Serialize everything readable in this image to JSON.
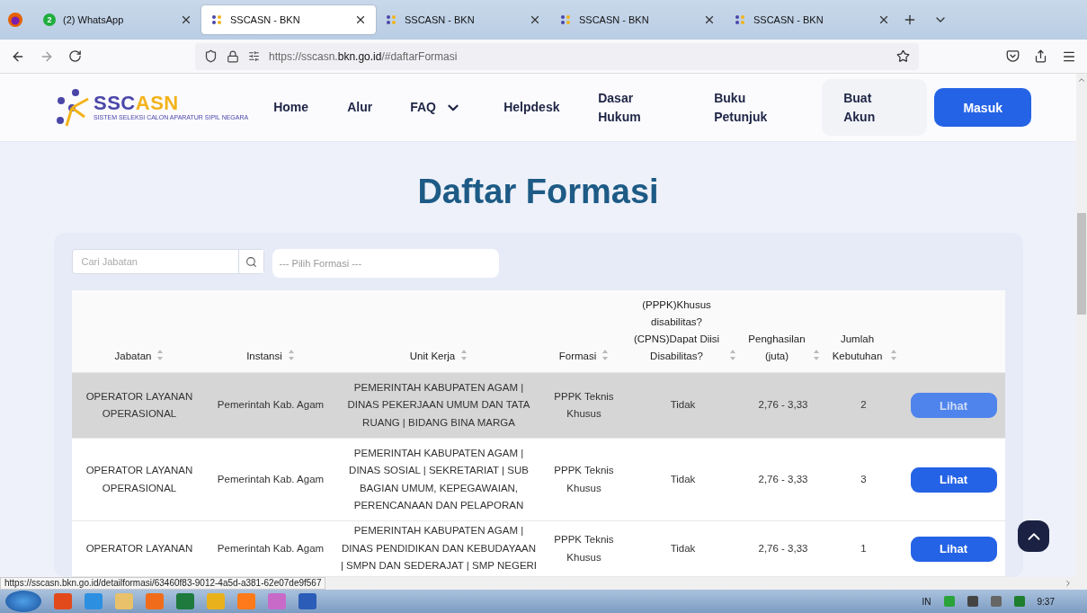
{
  "browser": {
    "tabs": [
      {
        "label": "(2) WhatsApp",
        "badge": "2",
        "kind": "whatsapp",
        "selected": false
      },
      {
        "label": "SSCASN - BKN",
        "kind": "sscasn",
        "selected": true
      },
      {
        "label": "SSCASN - BKN",
        "kind": "sscasn",
        "selected": false
      },
      {
        "label": "SSCASN - BKN",
        "kind": "sscasn",
        "selected": false
      },
      {
        "label": "SSCASN - BKN",
        "kind": "sscasn",
        "selected": false
      }
    ],
    "url_prefix": "https://sscasn.",
    "url_domain": "bkn.go.id",
    "url_path": "/#daftarFormasi"
  },
  "header": {
    "logo_text_a": "SSC",
    "logo_text_b": "ASN",
    "logo_tagline": "SISTEM SELEKSI CALON APARATUR SIPIL NEGARA",
    "nav": [
      {
        "label": "Home",
        "kind": "link"
      },
      {
        "label": "Alur",
        "kind": "link"
      },
      {
        "label": "FAQ",
        "kind": "dropdown"
      },
      {
        "label": "Helpdesk",
        "kind": "link"
      },
      {
        "label": "Dasar Hukum",
        "kind": "link"
      },
      {
        "label": "Buku Petunjuk",
        "kind": "link"
      },
      {
        "label": "Buat Akun",
        "kind": "pill"
      }
    ],
    "login_button": "Masuk"
  },
  "title": "Daftar Formasi",
  "filters": {
    "search_placeholder": "Cari Jabatan",
    "select_placeholder": "--- Pilih Formasi ---"
  },
  "table": {
    "columns": [
      "Jabatan",
      "Instansi",
      "Unit Kerja",
      "Formasi",
      "(PPPK)Khusus disabilitas? (CPNS)Dapat Diisi Disabilitas?",
      "Penghasilan (juta)",
      "Jumlah Kebutuhan"
    ],
    "rows": [
      {
        "selected": true,
        "cells": [
          "OPERATOR LAYANAN OPERASIONAL",
          "Pemerintah Kab. Agam",
          "PEMERINTAH KABUPATEN AGAM | DINAS PEKERJAAN UMUM DAN TATA RUANG | BIDANG BINA MARGA",
          "PPPK Teknis Khusus",
          "Tidak",
          "2,76 - 3,33",
          "2"
        ],
        "action": "Lihat"
      },
      {
        "selected": false,
        "cells": [
          "OPERATOR LAYANAN OPERASIONAL",
          "Pemerintah Kab. Agam",
          "PEMERINTAH KABUPATEN AGAM | DINAS SOSIAL | SEKRETARIAT | SUB BAGIAN UMUM, KEPEGAWAIAN, PERENCANAAN DAN PELAPORAN",
          "PPPK Teknis Khusus",
          "Tidak",
          "2,76 - 3,33",
          "3"
        ],
        "action": "Lihat"
      },
      {
        "selected": false,
        "cells": [
          "OPERATOR LAYANAN",
          "Pemerintah Kab. Agam",
          "PEMERINTAH KABUPATEN AGAM | DINAS PENDIDIKAN DAN KEBUDAYAAN | SMPN DAN SEDERAJAT | SMP NEGERI",
          "PPPK Teknis Khusus",
          "Tidak",
          "2,76 - 3,33",
          "1"
        ],
        "action": "Lihat"
      }
    ]
  },
  "status_url": "https://sscasn.bkn.go.id/detailformasi/63460f83-9012-4a5d-a381-62e07de9f567",
  "taskbar": {
    "language": "IN",
    "time": "9:37"
  }
}
